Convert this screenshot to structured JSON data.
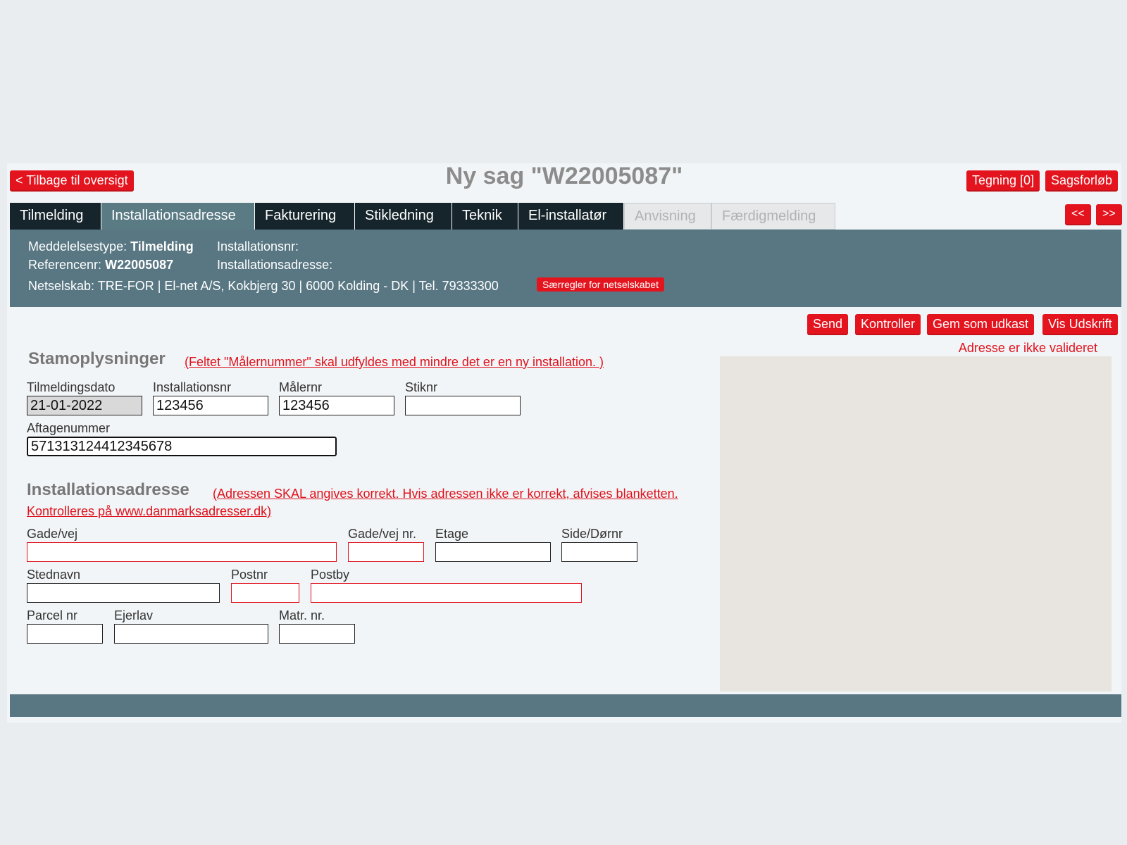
{
  "header": {
    "back_button": "< Tilbage til oversigt",
    "title": "Ny sag \"W22005087\"",
    "tegning_button": "Tegning [0]",
    "sagsforloeb_button": "Sagsforløb"
  },
  "tabs": [
    {
      "label": "Tilmelding",
      "state": "normal"
    },
    {
      "label": "Installationsadresse",
      "state": "active"
    },
    {
      "label": "Fakturering",
      "state": "normal"
    },
    {
      "label": "Stikledning",
      "state": "normal"
    },
    {
      "label": "Teknik",
      "state": "normal"
    },
    {
      "label": "El-installatør",
      "state": "normal"
    },
    {
      "label": "Anvisning",
      "state": "disabled"
    },
    {
      "label": "Færdigmelding",
      "state": "disabled"
    }
  ],
  "nav": {
    "prev": "<<",
    "next": ">>"
  },
  "info": {
    "meddelelsestype_label": "Meddelelsestype:",
    "meddelelsestype_value": "Tilmelding",
    "referencenr_label": "Referencenr:",
    "referencenr_value": "W22005087",
    "installationsnr_label": "Installationsnr:",
    "installationsadresse_label": "Installationsadresse:",
    "netselskab_line": "Netselskab: TRE-FOR | El-net A/S, Kokbjerg 30 | 6000 Kolding - DK | Tel. 79333300",
    "rules_badge": "Særregler for netselskabet"
  },
  "actions": {
    "send": "Send",
    "kontroller": "Kontroller",
    "gem": "Gem som udkast",
    "udskrift": "Vis Udskrift",
    "address_status": "Adresse er ikke valideret"
  },
  "stam": {
    "title": "Stamoplysninger",
    "note": "(Feltet \"Målernummer\" skal udfyldes med mindre det er en ny installation. )",
    "tilmeldingsdato_label": "Tilmeldingsdato",
    "tilmeldingsdato_value": "21-01-2022",
    "installationsnr_label": "Installationsnr",
    "installationsnr_value": "123456",
    "maalernr_label": "Målernr",
    "maalernr_value": "123456",
    "stiknr_label": "Stiknr",
    "stiknr_value": "",
    "aftagenummer_label": "Aftagenummer",
    "aftagenummer_value": "571313124412345678"
  },
  "adresse": {
    "title": "Installationsadresse",
    "note1": "(Adressen SKAL angives korrekt. Hvis adressen ikke er korrekt, afvises blanketten.",
    "note2": "Kontrolleres på www.danmarksadresser.dk)",
    "gade_label": "Gade/vej",
    "gadenr_label": "Gade/vej nr.",
    "etage_label": "Etage",
    "side_label": "Side/Dørnr",
    "stednavn_label": "Stednavn",
    "postnr_label": "Postnr",
    "postby_label": "Postby",
    "parcel_label": "Parcel nr",
    "ejerlav_label": "Ejerlav",
    "matr_label": "Matr. nr."
  },
  "colors": {
    "accent_red": "#e4141e",
    "tab_dark": "#16242b",
    "panel_teal": "#587782"
  }
}
